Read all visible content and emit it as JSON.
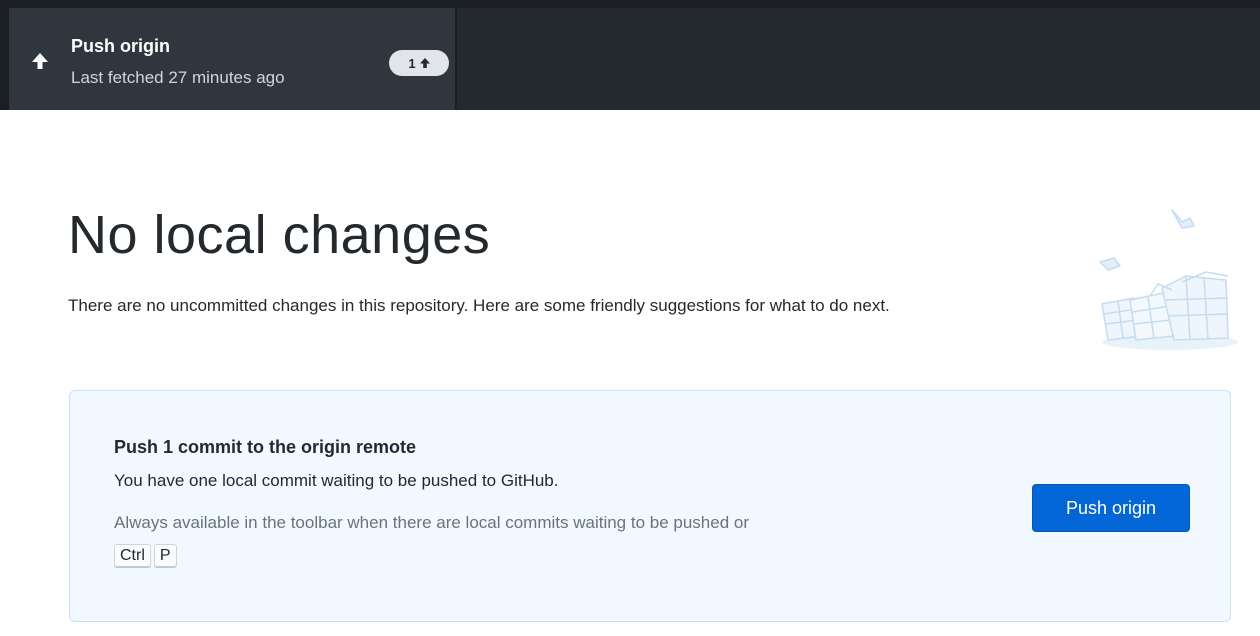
{
  "toolbar": {
    "push_button": {
      "title": "Push origin",
      "description": "Last fetched 27 minutes ago",
      "ahead_count": "1",
      "icon": "arrow-up-icon"
    }
  },
  "blankslate": {
    "heading": "No local changes",
    "description": "There are no uncommitted changes in this repository. Here are some friendly suggestions for what to do next.",
    "illustration": "paper-boxes-illustration"
  },
  "suggestion_card": {
    "title": "Push 1 commit to the origin remote",
    "description": "You have one local commit waiting to be pushed to GitHub.",
    "hint": "Always available in the toolbar when there are local commits waiting to be pushed or",
    "shortcut_keys": [
      "Ctrl",
      "P"
    ],
    "button_label": "Push origin"
  },
  "colors": {
    "toolbar_bg": "#24292e",
    "button_primary": "#0366d6",
    "card_bg": "#f1f8ff",
    "card_border": "#c8e1ff"
  }
}
